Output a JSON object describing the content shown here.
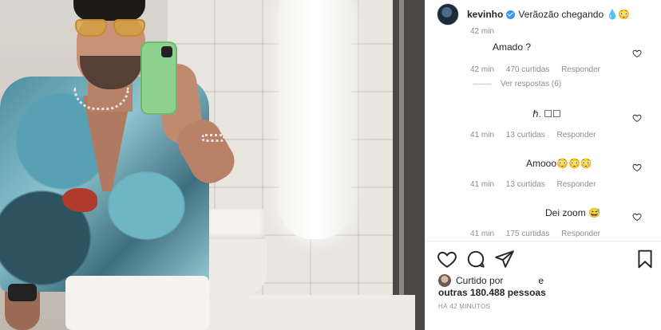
{
  "post": {
    "username": "kevinho",
    "caption": "Verãozão chegando 💧😳",
    "time": "42 min"
  },
  "comments": [
    {
      "text": "Amado ?",
      "time": "42 min",
      "likes": "470 curtidas",
      "reply": "Responder",
      "view_replies": "Ver respostas (6)"
    },
    {
      "text": "ℏ. ☐☐",
      "time": "41 min",
      "likes": "13 curtidas",
      "reply": "Responder"
    },
    {
      "text": "Amooo😳😳😳",
      "time": "41 min",
      "likes": "13 curtidas",
      "reply": "Responder"
    },
    {
      "text": "Dei zoom 😅",
      "time": "41 min",
      "likes": "175 curtidas",
      "reply": "Responder"
    }
  ],
  "footer": {
    "liked_by": "Curtido por",
    "liked_by_suffix": "e",
    "likes_count": "outras 180.488 pessoas",
    "ago": "HÁ 42 MINUTOS"
  },
  "icons": [
    "heart-icon",
    "comment-icon",
    "share-icon",
    "bookmark-icon",
    "verified-badge-icon"
  ],
  "colors": {
    "verified": "#3897f0",
    "meta": "#8e8e8e",
    "text": "#262626"
  }
}
